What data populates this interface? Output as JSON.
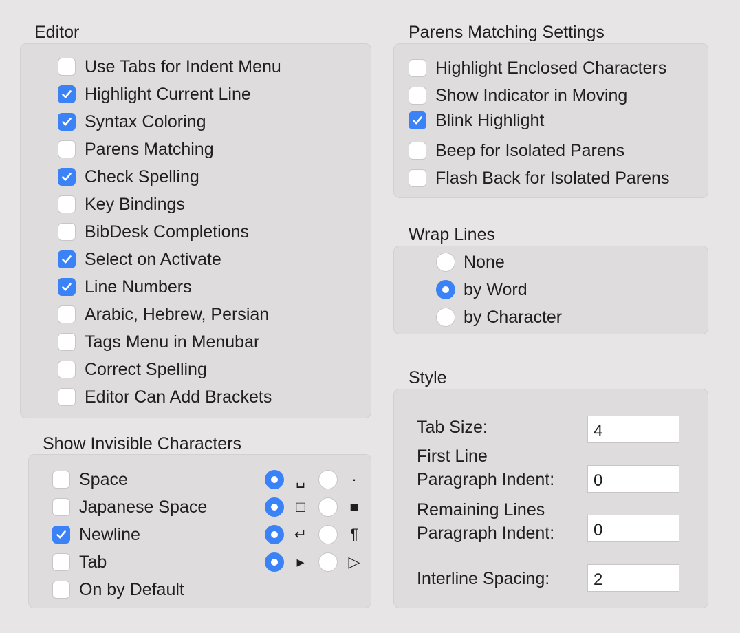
{
  "editor": {
    "title": "Editor",
    "items": [
      {
        "label": "Use Tabs for Indent Menu",
        "checked": false
      },
      {
        "label": "Highlight Current Line",
        "checked": true
      },
      {
        "label": "Syntax Coloring",
        "checked": true
      },
      {
        "label": "Parens Matching",
        "checked": false
      },
      {
        "label": "Check Spelling",
        "checked": true
      },
      {
        "label": "Key Bindings",
        "checked": false
      },
      {
        "label": "BibDesk Completions",
        "checked": false
      },
      {
        "label": "Select on Activate",
        "checked": true
      },
      {
        "label": "Line Numbers",
        "checked": true
      },
      {
        "label": "Arabic, Hebrew, Persian",
        "checked": false
      },
      {
        "label": "Tags Menu in Menubar",
        "checked": false
      },
      {
        "label": "Correct Spelling",
        "checked": false
      },
      {
        "label": "Editor Can Add Brackets",
        "checked": false
      }
    ]
  },
  "invisible": {
    "title": "Show Invisible Characters",
    "items": [
      {
        "label": "Space",
        "checked": false,
        "sym_a": "␣",
        "sym_b": "·",
        "selected": "a"
      },
      {
        "label": "Japanese Space",
        "checked": false,
        "sym_a": "□",
        "sym_b": "■",
        "selected": "a"
      },
      {
        "label": "Newline",
        "checked": true,
        "sym_a": "↵",
        "sym_b": "¶",
        "selected": "a"
      },
      {
        "label": "Tab",
        "checked": false,
        "sym_a": "▸",
        "sym_b": "▷",
        "selected": "a"
      },
      {
        "label": "On by Default",
        "checked": false
      }
    ]
  },
  "parens": {
    "title": "Parens Matching Settings",
    "items": [
      {
        "label": "Highlight Enclosed Characters",
        "checked": false
      },
      {
        "label": "Show Indicator in Moving",
        "checked": false
      },
      {
        "label": "Blink Highlight",
        "checked": true
      },
      {
        "label": "Beep for Isolated Parens",
        "checked": false
      },
      {
        "label": "Flash Back for Isolated Parens",
        "checked": false
      }
    ]
  },
  "wrap": {
    "title": "Wrap Lines",
    "options": [
      {
        "label": "None",
        "selected": false
      },
      {
        "label": "by Word",
        "selected": true
      },
      {
        "label": "by Character",
        "selected": false
      }
    ]
  },
  "style": {
    "title": "Style",
    "tab_size_label": "Tab Size:",
    "tab_size": "4",
    "first_line_label_1": "First Line",
    "first_line_label_2": "Paragraph Indent:",
    "first_line_indent": "0",
    "remaining_label_1": "Remaining Lines",
    "remaining_label_2": "Paragraph Indent:",
    "remaining_indent": "0",
    "interline_label": "Interline Spacing:",
    "interline": "2"
  },
  "colors": {
    "accent": "#3b82f7",
    "background": "#e7e5e6",
    "group_box": "#dedcdd"
  }
}
